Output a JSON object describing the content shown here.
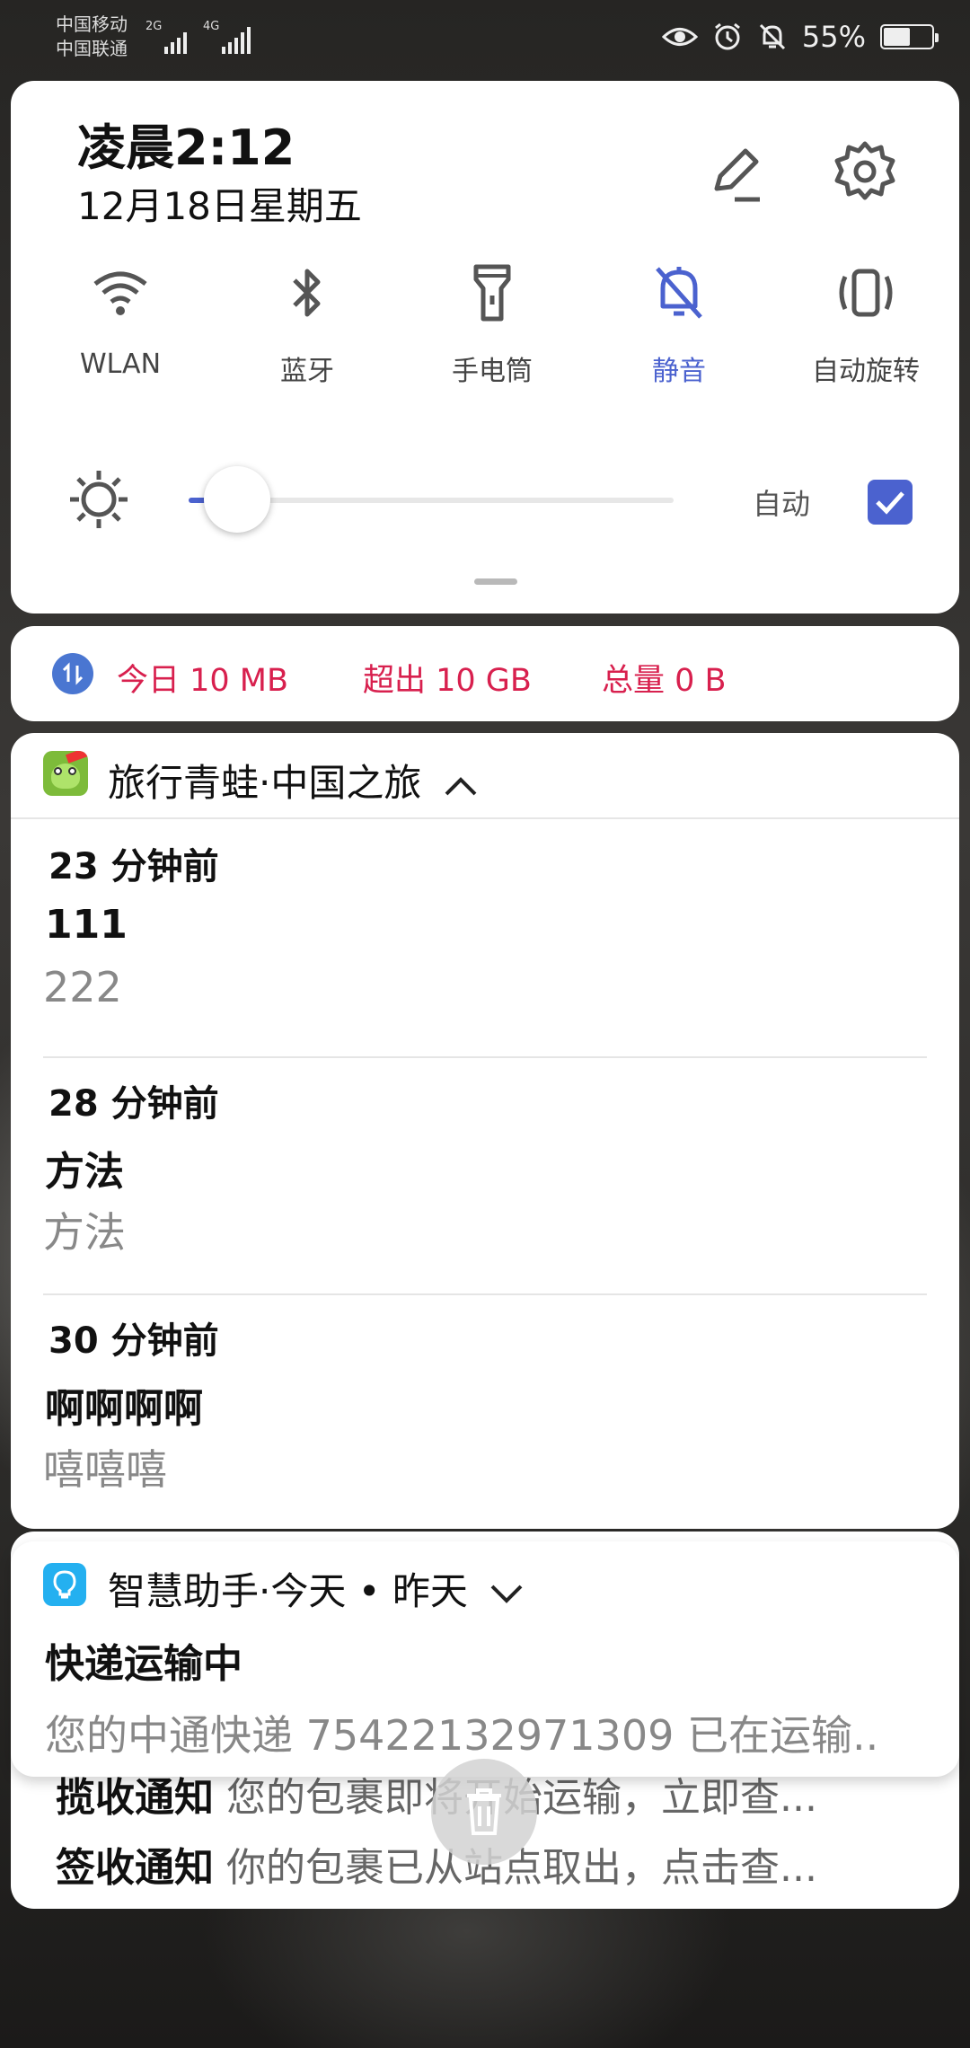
{
  "status_bar": {
    "carrier_1": "中国移动",
    "carrier_2": "中国联通",
    "sig1_label": "2G",
    "sig2_label": "4G",
    "battery_text": "55%",
    "battery_level": 0.55,
    "icons": [
      "eye-icon",
      "alarm-icon",
      "bell-off-icon",
      "battery-icon"
    ]
  },
  "quick_settings": {
    "time": "凌晨2:12",
    "date": "12月18日星期五",
    "tiles": [
      {
        "label": "WLAN",
        "icon": "wifi-icon",
        "active": false
      },
      {
        "label": "蓝牙",
        "icon": "bluetooth-icon",
        "active": false
      },
      {
        "label": "手电筒",
        "icon": "flashlight-icon",
        "active": false
      },
      {
        "label": "静音",
        "icon": "bell-off-icon",
        "active": true
      },
      {
        "label": "自动旋转",
        "icon": "rotate-icon",
        "active": false
      }
    ],
    "brightness_level": 0.05,
    "auto_label": "自动",
    "auto_checked": true,
    "accent_color": "#4b62cf"
  },
  "data_usage": {
    "today": "今日 10 MB",
    "over": "超出 10 GB",
    "total": "总量 0 B",
    "color": "#d8204e"
  },
  "notification_group": {
    "title": "旅行青蛙·中国之旅",
    "entries": [
      {
        "ago": "23 分钟前",
        "title": "111",
        "body": "222"
      },
      {
        "ago": "28 分钟前",
        "title": "方法",
        "body": "方法"
      },
      {
        "ago": "30 分钟前",
        "title": "啊啊啊啊",
        "body": "嘻嘻嘻"
      }
    ]
  },
  "assistant": {
    "title": "智慧助手·今天 • 昨天",
    "line1": "快递运输中",
    "line2": "您的中通快递 75422132971309 已在运输..",
    "sub1_title": "揽收通知",
    "sub1_body": "您的包裹即将开始运输，立即查...",
    "sub2_title": "签收通知",
    "sub2_body": "你的包裹已从站点取出，点击查..."
  }
}
